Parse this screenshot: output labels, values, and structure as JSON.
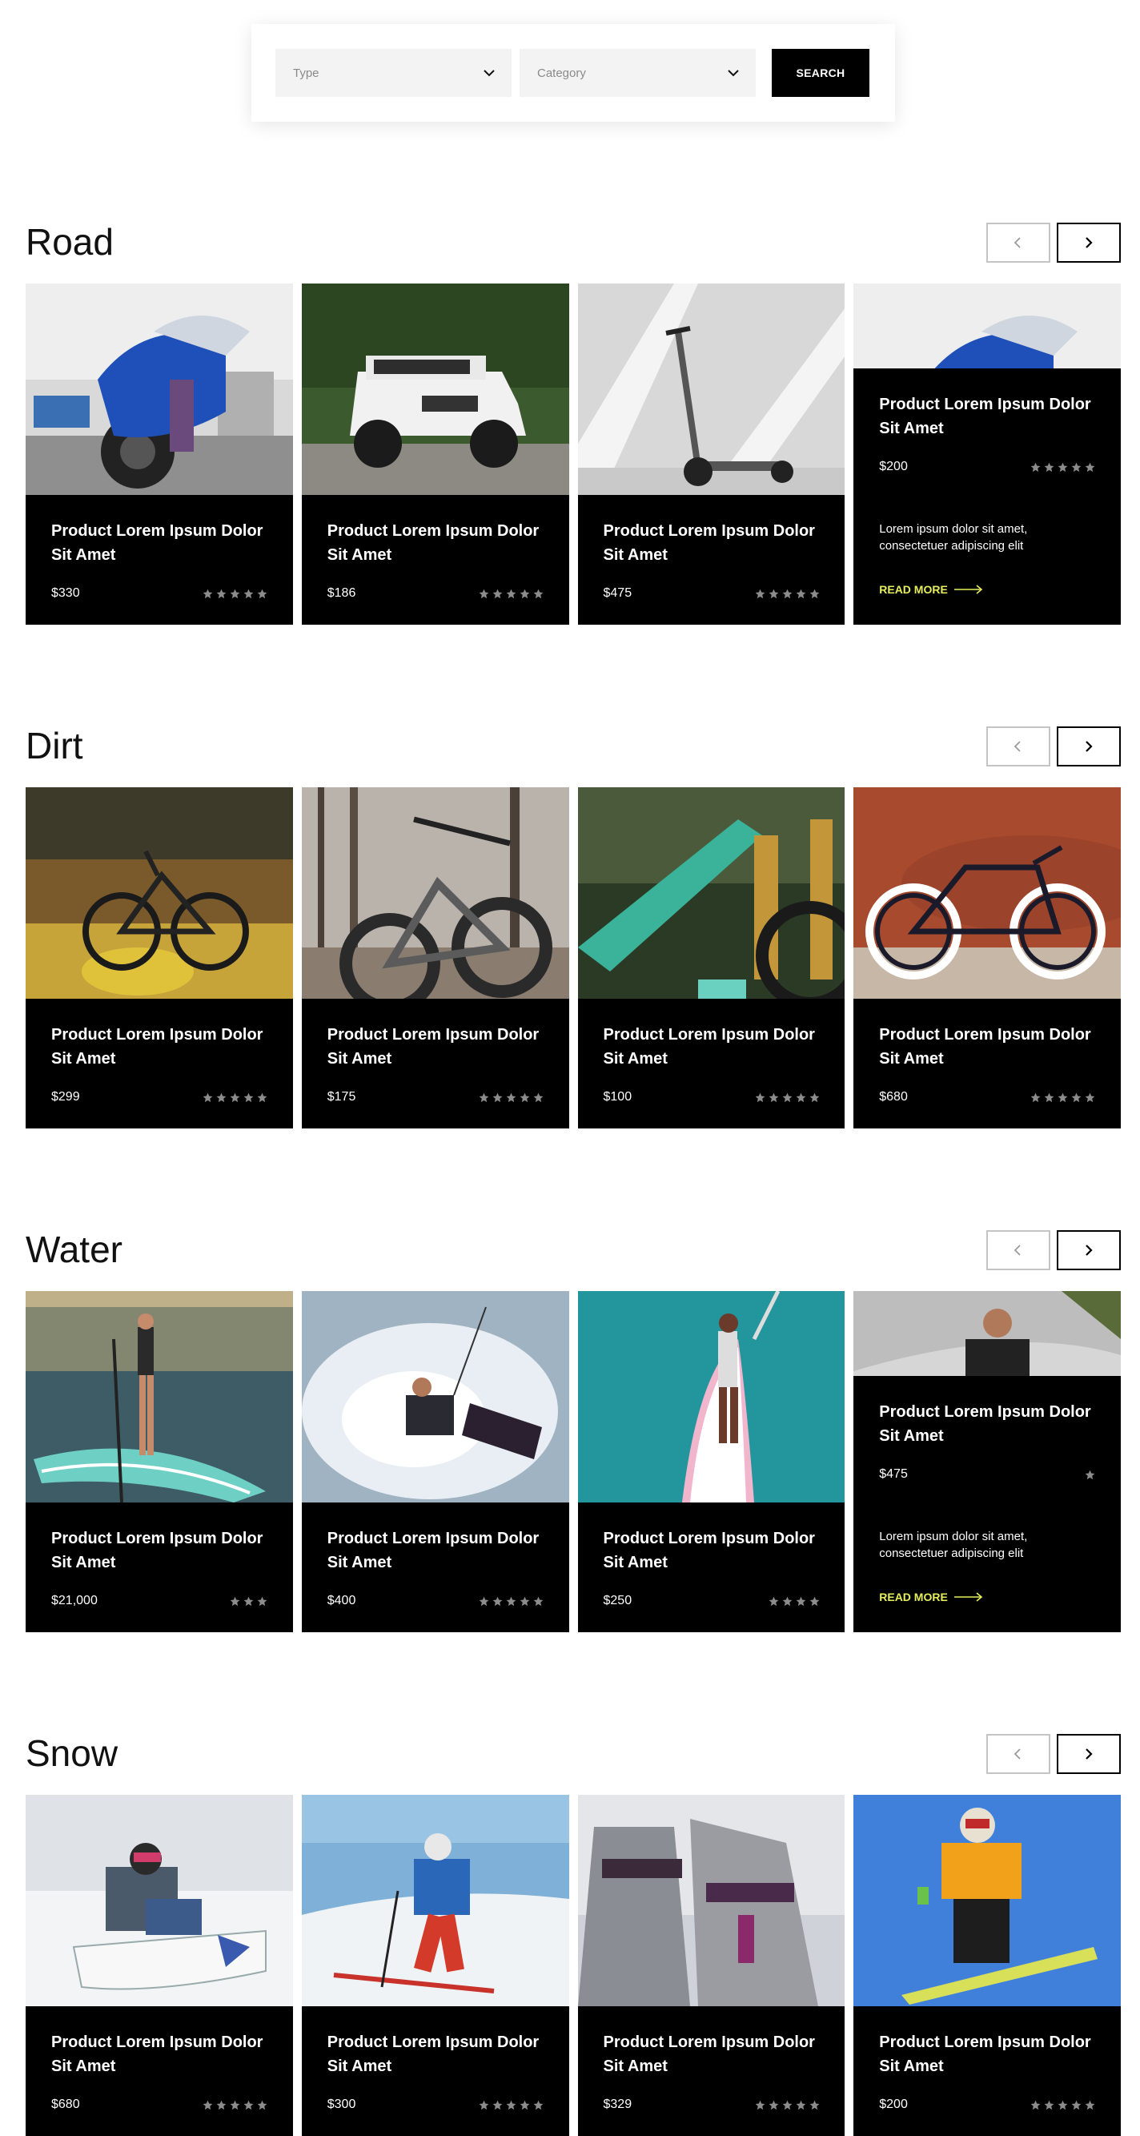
{
  "search": {
    "type_placeholder": "Type",
    "category_placeholder": "Category",
    "button_label": "SEARCH"
  },
  "colors": {
    "accent": "#e6ef5a",
    "card_bg": "#000000",
    "star": "#8c8c8c"
  },
  "sections": [
    {
      "title": "Road",
      "cards": [
        {
          "image": "motorcycle",
          "title": "Product Lorem Ipsum Dolor Sit Amet",
          "price": "$330",
          "rating": 5
        },
        {
          "image": "jeep",
          "title": "Product Lorem Ipsum Dolor Sit Amet",
          "price": "$186",
          "rating": 5
        },
        {
          "image": "scooter",
          "title": "Product Lorem Ipsum Dolor Sit Amet",
          "price": "$475",
          "rating": 5
        },
        {
          "image": "motorcycle",
          "title": "Product Lorem Ipsum Dolor Sit Amet",
          "price": "$200",
          "rating": 5,
          "expanded": true,
          "description": "Lorem ipsum dolor sit amet, consectetuer adipiscing elit",
          "read_more": "READ MORE"
        }
      ]
    },
    {
      "title": "Dirt",
      "cards": [
        {
          "image": "mtb-field",
          "title": "Product Lorem Ipsum Dolor Sit Amet",
          "price": "$299",
          "rating": 5
        },
        {
          "image": "fatbike",
          "title": "Product Lorem Ipsum Dolor Sit Amet",
          "price": "$175",
          "rating": 5
        },
        {
          "image": "green-bike",
          "title": "Product Lorem Ipsum Dolor Sit Amet",
          "price": "$100",
          "rating": 5
        },
        {
          "image": "fixie",
          "title": "Product Lorem Ipsum Dolor Sit Amet",
          "price": "$680",
          "rating": 5
        }
      ]
    },
    {
      "title": "Water",
      "cards": [
        {
          "image": "paddleboard",
          "title": "Product Lorem Ipsum Dolor Sit Amet",
          "price": "$21,000",
          "rating": 3
        },
        {
          "image": "kitesurf",
          "title": "Product Lorem Ipsum Dolor Sit Amet",
          "price": "$400",
          "rating": 5
        },
        {
          "image": "surfboard",
          "title": "Product Lorem Ipsum Dolor Sit Amet",
          "price": "$250",
          "rating": 4
        },
        {
          "image": "wetsuit",
          "title": "Product Lorem Ipsum Dolor Sit Amet",
          "price": "$475",
          "rating": 1,
          "expanded": true,
          "description": "Lorem ipsum dolor sit amet, consectetuer adipiscing elit",
          "read_more": "READ MORE"
        }
      ]
    },
    {
      "title": "Snow",
      "cards": [
        {
          "image": "snowboarder-sit",
          "title": "Product Lorem Ipsum Dolor Sit Amet",
          "price": "$680",
          "rating": 5
        },
        {
          "image": "skier",
          "title": "Product Lorem Ipsum Dolor Sit Amet",
          "price": "$300",
          "rating": 5
        },
        {
          "image": "snowshoes",
          "title": "Product Lorem Ipsum Dolor Sit Amet",
          "price": "$329",
          "rating": 5
        },
        {
          "image": "snowboard-jump",
          "title": "Product Lorem Ipsum Dolor Sit Amet",
          "price": "$200",
          "rating": 5
        }
      ]
    }
  ]
}
